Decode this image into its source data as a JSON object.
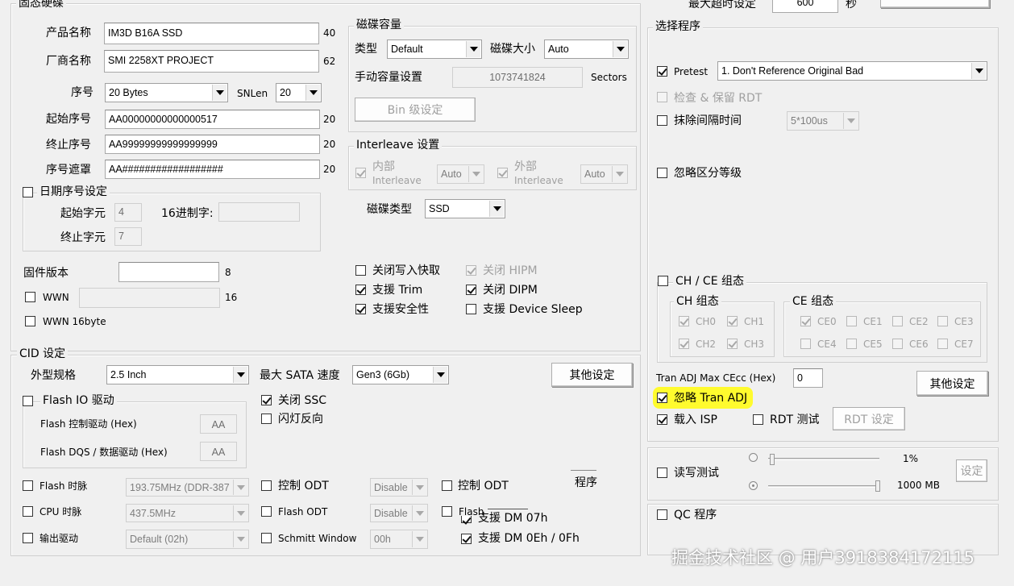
{
  "top": {
    "max_timeout_label": "最大超时设定",
    "max_timeout_value": "600",
    "seconds_unit": "秒"
  },
  "ssd": {
    "group_title": "固态硬碟",
    "product_name": {
      "label": "产品名称",
      "value": "IM3D B16A SSD",
      "len": "40"
    },
    "vendor_name": {
      "label": "厂商名称",
      "value": "SMI 2258XT PROJECT",
      "len": "62"
    },
    "serial": {
      "label": "序号",
      "select": "20 Bytes",
      "snlen_label": "SNLen",
      "snlen_value": "20"
    },
    "start_serial": {
      "label": "起始序号",
      "value": "AA00000000000000517",
      "len": "20"
    },
    "end_serial": {
      "label": "终止序号",
      "value": "AA99999999999999999",
      "len": "20"
    },
    "serial_mask": {
      "label": "序号遮罩",
      "value": "AA##################",
      "len": "20"
    },
    "date_serial": {
      "label": "日期序号设定",
      "start_char_label": "起始字元",
      "start_char_value": "4",
      "hex_label": "16进制字:",
      "end_char_label": "终止字元",
      "end_char_value": "7"
    },
    "fw": {
      "label": "固件版本",
      "len": "8"
    },
    "wwn": {
      "label": "WWN",
      "len": "16"
    },
    "wwn16": {
      "label": "WWN 16byte"
    }
  },
  "capacity": {
    "group_title": "磁碟容量",
    "type_label": "类型",
    "type_value": "Default",
    "size_label": "磁碟大小",
    "size_value": "Auto",
    "manual_label": "手动容量设置",
    "manual_value": "1073741824",
    "sectors_label": "Sectors",
    "bin_button": "Bin 级设定"
  },
  "interleave": {
    "group_title": "Interleave 设置",
    "inner_label": "内部",
    "inner_sub": "Interleave",
    "inner_value": "Auto",
    "outer_label": "外部",
    "outer_sub": "Interleave",
    "outer_value": "Auto"
  },
  "disk_type": {
    "label": "磁碟类型",
    "value": "SSD"
  },
  "features": {
    "write_cache": "关闭写入快取",
    "trim": "支援 Trim",
    "security": "支援安全性",
    "hipm": "关闭 HIPM",
    "dipm": "关闭 DIPM",
    "sleep": "支援 Device Sleep"
  },
  "cid": {
    "group_title": "CID 设定",
    "form_label": "外型规格",
    "form_value": "2.5 Inch",
    "sata_label": "最大 SATA 速度",
    "sata_value": "Gen3 (6Gb)",
    "other_button": "其他设定",
    "flash_io": {
      "label": "Flash IO 驱动",
      "ctrl_label": "Flash 控制驱动 (Hex)",
      "ctrl_value": "AA",
      "dqs_label": "Flash DQS / 数据驱动 (Hex)",
      "dqs_value": "AA"
    },
    "close_ssc": "关闭 SSC",
    "led_reverse": "闪灯反向",
    "flash_clock": {
      "label": "Flash 时脉",
      "value": "193.75MHz (DDR-387"
    },
    "cpu_clock": {
      "label": "CPU 时脉",
      "value": "437.5MHz"
    },
    "out_drive": {
      "label": "输出驱动",
      "value": "Default (02h)"
    },
    "ctrl_odt1": {
      "label": "控制 ODT",
      "value": "Disable"
    },
    "flash_odt": {
      "label": "Flash ODT",
      "value": "Disable"
    },
    "schmitt": {
      "label": "Schmitt Window",
      "value": "00h"
    },
    "ctrl_odt2": {
      "label": "控制 ODT"
    },
    "flash2": {
      "label": "Flash"
    },
    "program_label": "程序",
    "dm0": "支援 DM 07h",
    "dm1": "支援 DM 0Eh / 0Fh"
  },
  "program": {
    "group_title": "选择程序",
    "pretest_label": "Pretest",
    "pretest_value": "1. Don't Reference Original Bad",
    "check_rdt": "检查 & 保留 RDT",
    "erase_interval": "抹除间隔时间",
    "erase_value": "5*100us",
    "ignore_grade": "忽略区分等级",
    "chce": {
      "title": "CH / CE 组态",
      "ch_title": "CH 组态",
      "ce_title": "CE 组态",
      "ch": [
        "CH0",
        "CH1",
        "CH2",
        "CH3"
      ],
      "ce": [
        "CE0",
        "CE1",
        "CE2",
        "CE3",
        "CE4",
        "CE5",
        "CE6",
        "CE7"
      ]
    },
    "tran_adj_label": "Tran ADJ Max CEcc (Hex)",
    "tran_adj_value": "0",
    "other_button": "其他设定",
    "ignore_tran": "忽略 Tran ADJ",
    "load_isp": "载入 ISP",
    "rdt_test": "RDT 测试",
    "rdt_button": "RDT 设定",
    "rw_test": "读写测试",
    "pct": "1%",
    "mb": "1000 MB",
    "set_button": "设定",
    "qc": "QC 程序"
  },
  "watermark": "掘金技术社区 @ 用户3918384172115"
}
